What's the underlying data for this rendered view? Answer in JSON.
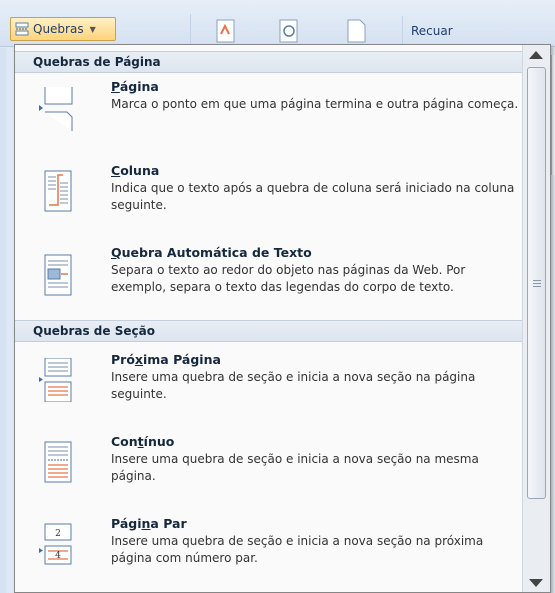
{
  "ribbon": {
    "quebras_label": "Quebras",
    "recuar_label": "Recuar"
  },
  "menu": {
    "sections": [
      {
        "header": "Quebras de Página",
        "items": [
          {
            "title_pre": "",
            "title_acc": "P",
            "title_post": "ágina",
            "description": "Marca o ponto em que uma página termina e outra página começa.",
            "icon": "page-break-icon"
          },
          {
            "title_pre": "",
            "title_acc": "C",
            "title_post": "oluna",
            "description": "Indica que o texto após a quebra de coluna será iniciado na coluna seguinte.",
            "icon": "column-break-icon"
          },
          {
            "title_pre": "",
            "title_acc": "Q",
            "title_post": "uebra Automática de Texto",
            "description": "Separa o texto ao redor do objeto nas páginas da Web. Por exemplo, separa o texto das legendas do corpo de texto.",
            "icon": "text-wrapping-break-icon"
          }
        ]
      },
      {
        "header": "Quebras de Seção",
        "items": [
          {
            "title_pre": "Pró",
            "title_acc": "x",
            "title_post": "ima Página",
            "description": "Insere uma quebra de seção e inicia a nova seção na página seguinte.",
            "icon": "next-page-section-icon"
          },
          {
            "title_pre": "Con",
            "title_acc": "t",
            "title_post": "ínuo",
            "description": "Insere uma quebra de seção e inicia a nova seção na mesma página.",
            "icon": "continuous-section-icon"
          },
          {
            "title_pre": "Pági",
            "title_acc": "n",
            "title_post": "a Par",
            "description": "Insere uma quebra de seção e inicia a nova seção na próxima página com número par.",
            "icon": "even-page-section-icon"
          }
        ]
      }
    ]
  },
  "icon_labels": {
    "even_top": "2",
    "even_bottom": "4"
  },
  "colors": {
    "accent_orange": "#e8734a",
    "header_bg": "#dde5ef",
    "button_highlight": "#ffd37a"
  }
}
